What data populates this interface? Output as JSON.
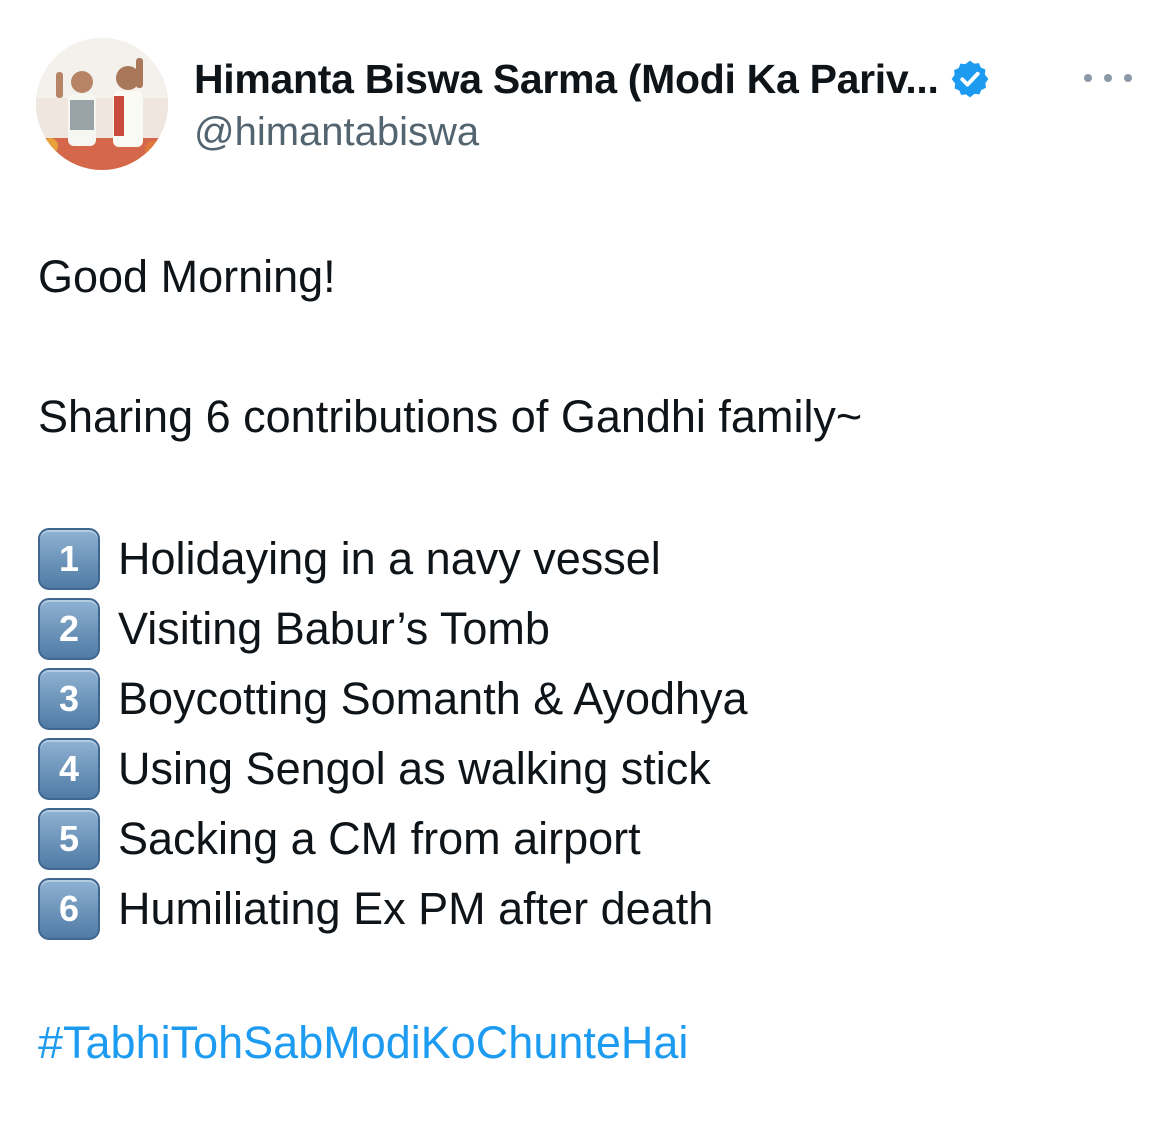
{
  "author": {
    "display_name": "Himanta Biswa Sarma (Modi Ka Pariv...",
    "handle": "@himantabiswa",
    "verified_icon": "verified-badge-icon",
    "avatar": "profile-photo",
    "more_icon": "more-options-icon"
  },
  "tweet": {
    "greeting": "Good Morning!",
    "intro": "Sharing 6 contributions of Gandhi family~",
    "items": [
      {
        "num": "1",
        "text": "Holidaying in a navy vessel"
      },
      {
        "num": "2",
        "text": "Visiting Babur’s Tomb"
      },
      {
        "num": "3",
        "text": "Boycotting Somanth & Ayodhya"
      },
      {
        "num": "4",
        "text": "Using Sengol as walking stick"
      },
      {
        "num": "5",
        "text": "Sacking a CM from airport"
      },
      {
        "num": "6",
        "text": "Humiliating Ex PM after death"
      }
    ],
    "hashtag": "#TabhiTohSabModiKoChunteHai"
  },
  "colors": {
    "text": "#0f1419",
    "secondary": "#536471",
    "link": "#1d9bf0",
    "verified": "#1d9bf0",
    "keycap": "#5a86b0"
  }
}
